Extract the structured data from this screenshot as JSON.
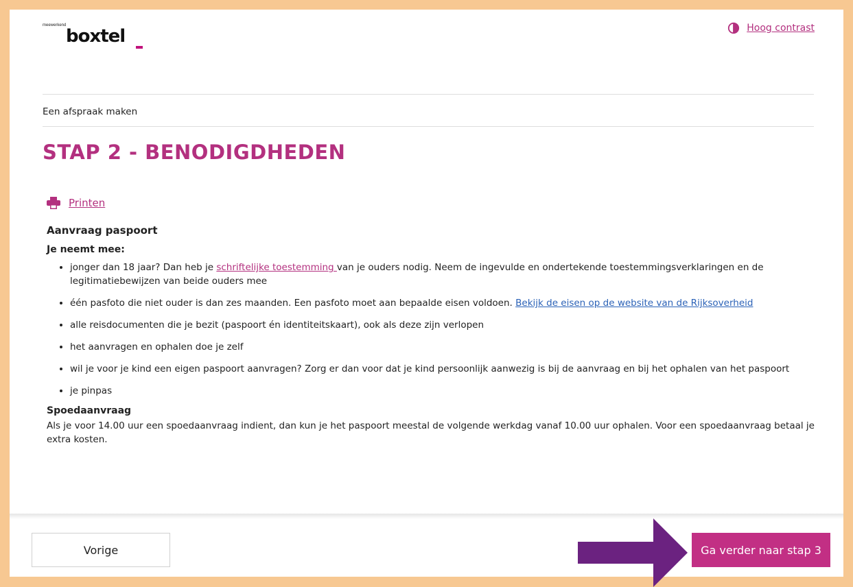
{
  "header": {
    "logo_tagline": "meewerkend",
    "logo_word": "boxtel",
    "contrast_label": "Hoog contrast"
  },
  "breadcrumb": "Een afspraak maken",
  "page_title": "STAP 2 - BENODIGDHEDEN",
  "print_label": "Printen",
  "content": {
    "heading": "Aanvraag paspoort",
    "subheading": "Je neemt mee:",
    "items": [
      {
        "pre": "jonger dan 18 jaar? Dan heb je ",
        "link": "schriftelijke toestemming ",
        "post": "van je ouders nodig.  Neem de ingevulde en ondertekende toestemmingsverklaringen en de legitimatiebewijzen van beide ouders mee"
      },
      {
        "pre": "één pasfoto die niet ouder is dan zes maanden. Een pasfoto moet aan bepaalde eisen voldoen. ",
        "link": "Bekijk de eisen op de website van de Rijksoverheid",
        "post": ""
      },
      {
        "text": "alle reisdocumenten die je bezit (paspoort én identiteitskaart), ook als deze zijn verlopen"
      },
      {
        "text": "het aanvragen en ophalen doe je zelf"
      },
      {
        "text": "wil je voor je kind een eigen paspoort aanvragen? Zorg er dan voor dat je kind persoonlijk aanwezig is bij de aanvraag en bij het ophalen van het paspoort"
      },
      {
        "text": "je pinpas"
      }
    ],
    "spoed_title": "Spoedaanvraag",
    "spoed_text": "Als je voor 14.00 uur een spoedaanvraag indient, dan kun je het paspoort meestal de volgende werkdag vanaf 10.00 uur ophalen. Voor een spoedaanvraag betaal je extra kosten."
  },
  "footer": {
    "prev_label": "Vorige",
    "next_label": "Ga verder naar stap 3"
  },
  "colors": {
    "accent": "#b3307f",
    "button": "#c22f84",
    "link_blue": "#2b62b7",
    "frame": "#f7c892",
    "arrow": "#6b2280"
  }
}
